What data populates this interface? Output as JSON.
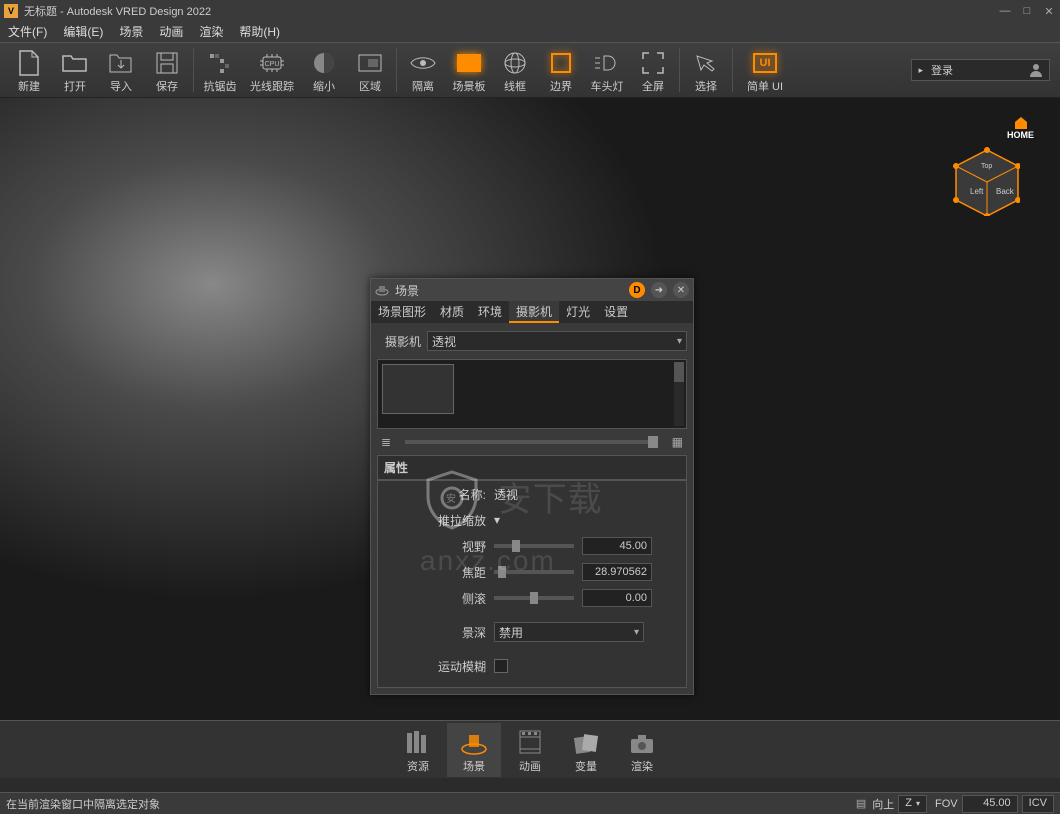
{
  "titlebar": {
    "app_icon_glyph": "V",
    "title": "无标题 - Autodesk VRED Design 2022"
  },
  "menu": {
    "file": "文件(F)",
    "edit": "编辑(E)",
    "scene": "场景",
    "animation": "动画",
    "render": "渲染",
    "help": "帮助(H)"
  },
  "toolbar": {
    "new": "新建",
    "open": "打开",
    "import": "导入",
    "save": "保存",
    "antialias": "抗锯齿",
    "raytrace": "光线跟踪",
    "shrink": "缩小",
    "region": "区域",
    "isolate": "隔离",
    "backplate": "场景板",
    "wireframe": "线框",
    "boundary": "边界",
    "headlight": "车头灯",
    "fullscreen": "全屏",
    "select": "选择",
    "simple_ui": "简单 UI",
    "login": "登录"
  },
  "viewcube": {
    "home": "HOME",
    "left": "Left",
    "back": "Back",
    "top": "Top"
  },
  "panel": {
    "title": "场景",
    "tabs": {
      "scenegraph": "场景图形",
      "material": "材质",
      "environment": "环境",
      "camera": "摄影机",
      "light": "灯光",
      "settings": "设置"
    },
    "camera_label": "摄影机",
    "camera_select": "透视",
    "section_props": "属性",
    "name_label": "名称:",
    "name_value": "透视",
    "zoom_label": "推拉缩放",
    "fov_label": "视野",
    "fov_value": "45.00",
    "focal_label": "焦距",
    "focal_value": "28.970562",
    "roll_label": "侧滚",
    "roll_value": "0.00",
    "dof_label": "景深",
    "dof_value": "禁用",
    "motion_blur_label": "运动模糊"
  },
  "watermark": "anxz.com",
  "bottom_tabs": {
    "assets": "资源",
    "scene": "场景",
    "animation": "动画",
    "variants": "变量",
    "render": "渲染"
  },
  "status": {
    "message": "在当前渲染窗口中隔离选定对象",
    "up_label": "向上",
    "up_axis": "Z",
    "fov_label": "FOV",
    "fov_value": "45.00",
    "icv": "ICV"
  }
}
